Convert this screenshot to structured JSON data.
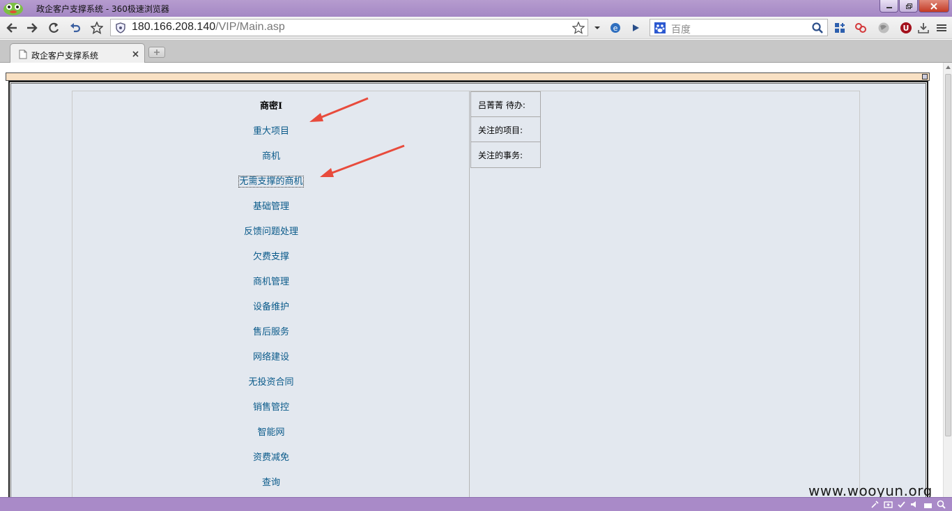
{
  "window": {
    "title": "政企客户支撑系统 - 360极速浏览器"
  },
  "toolbar": {
    "url_host": "180.166.208.140",
    "url_path": "/VIP/Main.asp",
    "search_placeholder": "百度"
  },
  "tabs": [
    {
      "label": "政企客户支撑系统"
    }
  ],
  "menu": {
    "title": "商密I",
    "items": [
      {
        "label": "重大项目"
      },
      {
        "label": "商机"
      },
      {
        "label": "无需支撑的商机"
      },
      {
        "label": "基础管理"
      },
      {
        "label": "反馈问题处理"
      },
      {
        "label": "欠费支撑"
      },
      {
        "label": "商机管理"
      },
      {
        "label": "设备维护"
      },
      {
        "label": "售后服务"
      },
      {
        "label": "网络建设"
      },
      {
        "label": "无投资合同"
      },
      {
        "label": "销售管控"
      },
      {
        "label": "智能网"
      },
      {
        "label": "资费减免"
      },
      {
        "label": "查询"
      }
    ]
  },
  "side_panel": {
    "rows": [
      {
        "label": "吕菁菁  待办:"
      },
      {
        "label": "关注的项目:"
      },
      {
        "label": "关注的事务:"
      }
    ]
  },
  "watermark": "www.wooyun.org",
  "colors": {
    "titlebar": "#a487c4",
    "page_bg": "#e3e8ef",
    "link": "#0a5a8a",
    "arrow": "#e84b3c",
    "frame_top": "#f9e1c4"
  }
}
